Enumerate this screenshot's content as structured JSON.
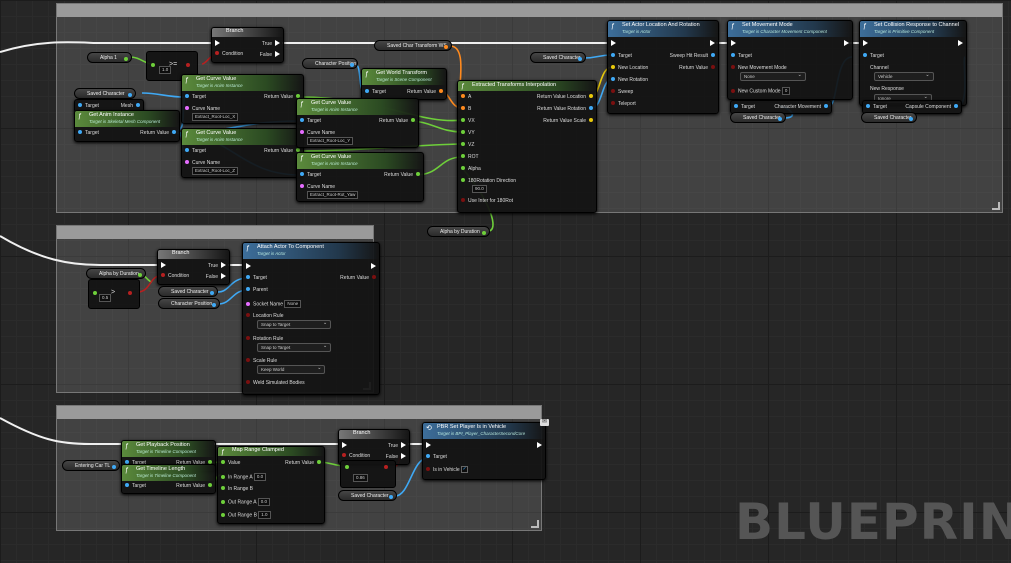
{
  "watermark": "BLUEPRINT",
  "branch1": {
    "title": "Branch",
    "condition": "Condition",
    "true": "True",
    "false": "False"
  },
  "branch2": {
    "title": "Branch",
    "condition": "Condition",
    "true": "True",
    "false": "False"
  },
  "branch3": {
    "title": "Branch",
    "condition": "Condition",
    "true": "True",
    "false": "False"
  },
  "vars": {
    "alpha1": "Alpha 1",
    "saved_char_transform": "Saved Char Transform WS",
    "character_position": "Character Position",
    "saved_character": "Saved Character",
    "saved_character_b": "Saved Character",
    "saved_character_c": "Saved Character",
    "saved_character_d": "Saved Character",
    "saved_character_e": "Saved Character",
    "saved_character_f": "Saved Character",
    "character_position_2": "Character Position",
    "alpha_by_duration": "Alpha by Duration",
    "alpha_by_duration_2": "Alpha by Duration",
    "entering_car_tl": "Entering Car TL"
  },
  "compare1": {
    "op": ">=",
    "value": "1.0"
  },
  "compare2": {
    "op": ">",
    "value": "0.5"
  },
  "compare3": {
    "value": "0.86"
  },
  "mesh_target": {
    "target": "Target",
    "mesh": "Mesh"
  },
  "anim_instance": {
    "title": "Get Anim Instance",
    "subtitle": "Target is Skeletal Mesh Component",
    "target": "Target",
    "ret": "Return Value"
  },
  "curve_x": {
    "title": "Get Curve Value",
    "subtitle": "Target is Anim Instance",
    "target": "Target",
    "ret": "Return Value",
    "curve_label": "Curve Name",
    "curve": "Extract_Root-Loc_X"
  },
  "curve_y": {
    "title": "Get Curve Value",
    "subtitle": "Target is Anim Instance",
    "target": "Target",
    "ret": "Return Value",
    "curve_label": "Curve Name",
    "curve": "Extract_Root-Loc_Y"
  },
  "curve_z": {
    "title": "Get Curve Value",
    "subtitle": "Target is Anim Instance",
    "target": "Target",
    "ret": "Return Value",
    "curve_label": "Curve Name",
    "curve": "Extract_Root-Loc_Z"
  },
  "curve_yaw": {
    "title": "Get Curve Value",
    "subtitle": "Target is Anim Instance",
    "target": "Target",
    "ret": "Return Value",
    "curve_label": "Curve Name",
    "curve": "Extract_Root-Rot_Yaw"
  },
  "world_transform": {
    "title": "Get World Transform",
    "subtitle": "Target is Scene Component",
    "target": "Target",
    "ret": "Return Value"
  },
  "interp": {
    "title": "Extracted Transforms Interpolation",
    "a": "A",
    "b": "B",
    "vx": "VX",
    "vy": "VY",
    "vz": "VZ",
    "rot": "ROT",
    "alpha": "Alpha",
    "dir_label": "180Rotation Direction",
    "dir_value": "90.0",
    "use_inter": "Use Inter for 180Rot",
    "out_loc": "Return Value Location",
    "out_rot": "Return Value Rotation",
    "out_scale": "Return Value Scale"
  },
  "set_actor_loc": {
    "title": "Set Actor Location And Rotation",
    "subtitle": "Target is Actor",
    "target": "Target",
    "new_location": "New Location",
    "new_rotation": "New Rotation",
    "sweep": "Sweep",
    "teleport": "Teleport",
    "sweep_hit": "Sweep Hit Result",
    "ret": "Return Value"
  },
  "set_movement": {
    "title": "Set Movement Mode",
    "subtitle": "Target is Character Movement Component",
    "target": "Target",
    "new_mode": "New Movement Mode",
    "mode_value": "None",
    "custom_mode": "New Custom Mode",
    "custom_value": "0"
  },
  "char_movement": {
    "target": "Target",
    "label": "Character Movement"
  },
  "set_collision": {
    "title": "Set Collision Response to Channel",
    "subtitle": "Target is Primitive Component",
    "target": "Target",
    "channel": "Channel",
    "channel_value": "Vehicle",
    "new_response": "New Response",
    "response_value": "Ignore"
  },
  "capsule": {
    "target": "Target",
    "label": "Capsule Component"
  },
  "attach": {
    "title": "Attach Actor To Component",
    "subtitle": "Target is Actor",
    "target": "Target",
    "parent": "Parent",
    "socket_label": "Socket Name",
    "socket_value": "None",
    "ret": "Return Value",
    "loc_rule": "Location Rule",
    "loc_value": "Snap to Target",
    "rot_rule": "Rotation Rule",
    "rot_value": "Snap to Target",
    "scale_rule": "Scale Rule",
    "scale_value": "Keep World",
    "weld": "Weld Simulated Bodies"
  },
  "playback": {
    "title": "Get Playback Position",
    "subtitle": "Target is Timeline Component",
    "target": "Target",
    "ret": "Return Value"
  },
  "timeline_len": {
    "title": "Get Timeline Length",
    "subtitle": "Target is Timeline Component",
    "target": "Target",
    "ret": "Return Value"
  },
  "map_range": {
    "title": "Map Range Clamped",
    "value": "Value",
    "ret": "Return Value",
    "in_a": "In Range A",
    "in_a_v": "0.0",
    "in_b": "In Range B",
    "out_a": "Out Range A",
    "out_a_v": "0.0",
    "out_b": "Out Range B",
    "out_b_v": "1.0"
  },
  "set_in_vehicle": {
    "title": "PBR Set Player Is in Vehicle",
    "subtitle": "Target is BPI_Player_CharacterSecondCore",
    "target": "Target",
    "in_vehicle": "Is in Vehicle"
  }
}
